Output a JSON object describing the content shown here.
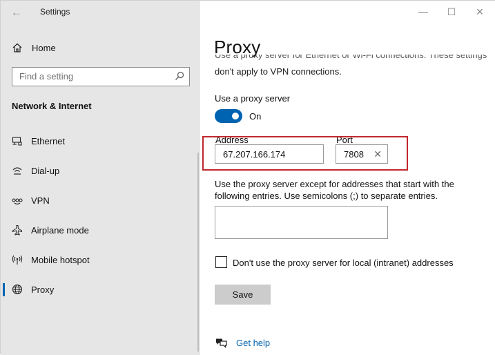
{
  "window": {
    "app_title": "Settings",
    "back_glyph": "←",
    "minimize_glyph": "—",
    "maximize_glyph": "☐",
    "close_glyph": "✕"
  },
  "sidebar": {
    "home_label": "Home",
    "search_placeholder": "Find a setting",
    "section_title": "Network & Internet",
    "items": [
      {
        "label": "Ethernet",
        "icon": "ethernet-icon"
      },
      {
        "label": "Dial-up",
        "icon": "dialup-icon"
      },
      {
        "label": "VPN",
        "icon": "vpn-icon"
      },
      {
        "label": "Airplane mode",
        "icon": "airplane-icon"
      },
      {
        "label": "Mobile hotspot",
        "icon": "hotspot-icon"
      },
      {
        "label": "Proxy",
        "icon": "globe-icon",
        "active": true
      }
    ]
  },
  "main": {
    "title": "Proxy",
    "partial_line": "Use a proxy server for Ethernet or Wi-Fi connections. These settings",
    "desc_line": "don't apply to VPN connections.",
    "use_proxy_label": "Use a proxy server",
    "toggle_state": "On",
    "address_label": "Address",
    "address_value": "67.207.166.174",
    "port_label": "Port",
    "port_value": "7808",
    "clear_glyph": "✕",
    "exceptions_line1": "Use the proxy server except for addresses that start with the",
    "exceptions_line2": "following entries. Use semicolons (;) to separate entries.",
    "exceptions_value": "",
    "local_checkbox_label": "Don't use the proxy server for local (intranet) addresses",
    "local_checkbox_checked": false,
    "save_label": "Save",
    "help_label": "Get help"
  },
  "colors": {
    "accent": "#0063b1",
    "highlight_box": "#c1272d",
    "sidebar_bg": "#e6e6e6"
  }
}
